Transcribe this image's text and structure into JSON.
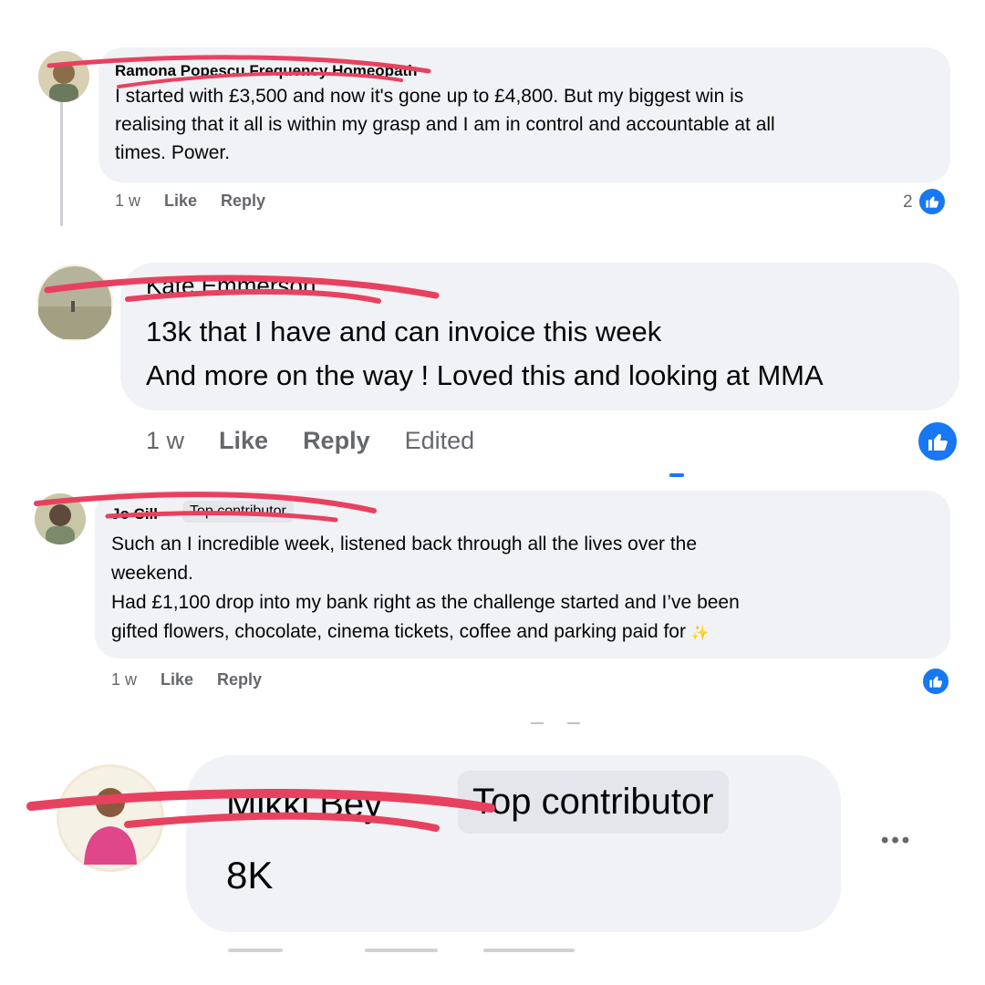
{
  "comments": [
    {
      "author": "Ramona Popescu Frequency Homeopath",
      "text": "I started with £3,500 and now it's gone up to £4,800. But my biggest win is\nrealising that it all is within my grasp and I am in control and accountable at all\ntimes. Power.",
      "time": "1 w",
      "like_label": "Like",
      "reply_label": "Reply",
      "reaction_count": "2"
    },
    {
      "author": "Kate Emmerson",
      "text": "13k that I have and can invoice this week\nAnd more on the way ! Loved this and looking at MMA",
      "time": "1 w",
      "like_label": "Like",
      "reply_label": "Reply",
      "edited_label": "Edited"
    },
    {
      "author": "Jo Cill",
      "badge": "Top contributor",
      "text": "Such an I incredible week, listened back through all the lives over the\nweekend.\nHad £1,100 drop into my bank right as the challenge started and I’ve been\ngifted flowers, chocolate, cinema tickets, coffee and parking paid for",
      "emoji": "✨",
      "time": "1 w",
      "like_label": "Like",
      "reply_label": "Reply"
    },
    {
      "author": "Mikki Bey",
      "badge": "Top contributor",
      "text": "8K",
      "more_label": "•••"
    }
  ],
  "icons": {
    "like_reaction": "thumbs-up-icon",
    "more": "more-options-icon"
  },
  "colors": {
    "like_blue": "#1877f2",
    "redaction": "#e8415f",
    "bubble": "#f0f2f5"
  }
}
